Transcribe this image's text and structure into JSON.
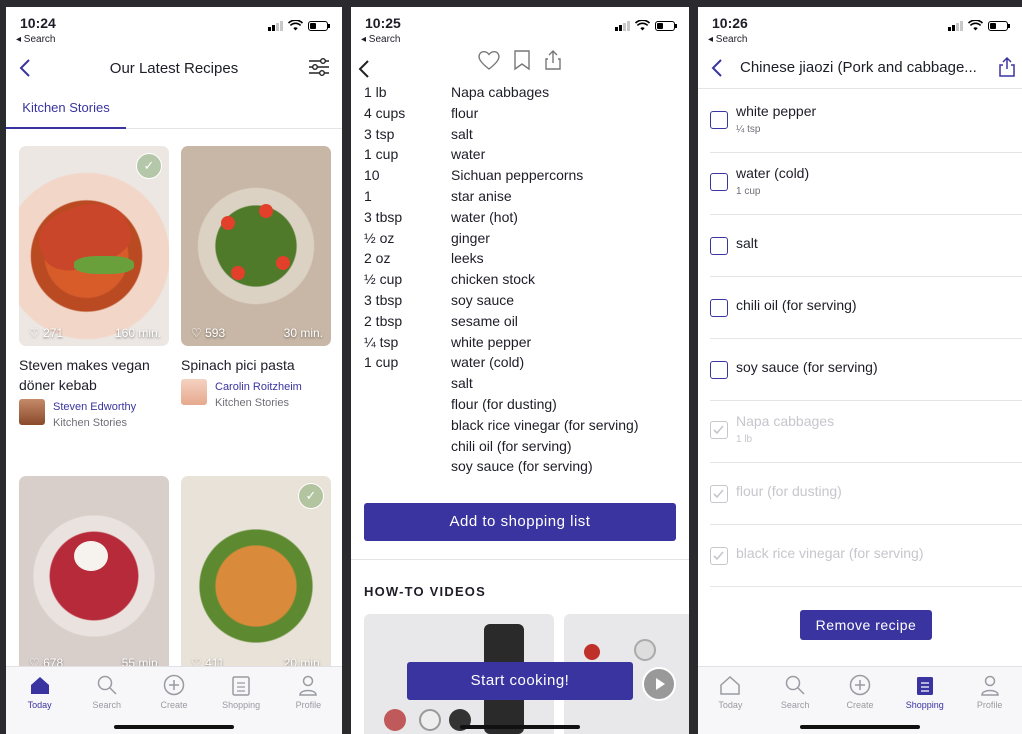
{
  "colors": {
    "accent": "#3a34a0",
    "muted": "#9a9aa3",
    "disabled": "#c6c6cc"
  },
  "screen1": {
    "status": {
      "time": "10:24",
      "back": "◂ Search"
    },
    "title": "Our Latest Recipes",
    "tab": "Kitchen Stories",
    "cards": [
      {
        "likes": "271",
        "time": "160 min.",
        "title": "Steven makes vegan döner kebab",
        "author": "Steven Edworthy",
        "publisher": "Kitchen Stories"
      },
      {
        "likes": "593",
        "time": "30 min.",
        "title": "Spinach pici pasta",
        "author": "Carolin Roitzheim",
        "publisher": "Kitchen Stories"
      },
      {
        "likes": "678",
        "time": "55 min."
      },
      {
        "likes": "411",
        "time": "20 min."
      }
    ],
    "tabbar": [
      "Today",
      "Search",
      "Create",
      "Shopping",
      "Profile"
    ]
  },
  "screen2": {
    "status": {
      "time": "10:25",
      "back": "◂ Search"
    },
    "ingredients": [
      {
        "q": "1 lb",
        "n": "Napa cabbages"
      },
      {
        "q": "4 cups",
        "n": "flour"
      },
      {
        "q": "3 tsp",
        "n": "salt"
      },
      {
        "q": "1 cup",
        "n": "water"
      },
      {
        "q": "10",
        "n": "Sichuan peppercorns"
      },
      {
        "q": "1",
        "n": "star anise"
      },
      {
        "q": "3 tbsp",
        "n": "water (hot)"
      },
      {
        "q": "½ oz",
        "n": "ginger"
      },
      {
        "q": "2 oz",
        "n": "leeks"
      },
      {
        "q": "½ cup",
        "n": "chicken stock"
      },
      {
        "q": "3 tbsp",
        "n": "soy sauce"
      },
      {
        "q": "2 tbsp",
        "n": "sesame oil"
      },
      {
        "q": "¼ tsp",
        "n": "white pepper"
      },
      {
        "q": "1 cup",
        "n": "water (cold)"
      },
      {
        "q": "",
        "n": "salt"
      },
      {
        "q": "",
        "n": "flour (for dusting)"
      },
      {
        "q": "",
        "n": "black rice vinegar (for serving)"
      },
      {
        "q": "",
        "n": "chili oil (for serving)"
      },
      {
        "q": "",
        "n": "soy sauce (for serving)"
      }
    ],
    "add_button": "Add to shopping list",
    "howto": "HOW-TO VIDEOS",
    "start_button": "Start cooking!"
  },
  "screen3": {
    "status": {
      "time": "10:26",
      "back": "◂ Search"
    },
    "title": "Chinese jiaozi (Pork and cabbage...",
    "items": [
      {
        "name": "white pepper",
        "amount": "¼ tsp",
        "done": false
      },
      {
        "name": "water (cold)",
        "amount": "1 cup",
        "done": false
      },
      {
        "name": "salt",
        "amount": "",
        "done": false
      },
      {
        "name": "chili oil (for serving)",
        "amount": "",
        "done": false
      },
      {
        "name": "soy sauce (for serving)",
        "amount": "",
        "done": false
      },
      {
        "name": "Napa cabbages",
        "amount": "1 lb",
        "done": true
      },
      {
        "name": "flour (for dusting)",
        "amount": "",
        "done": true
      },
      {
        "name": "black rice vinegar (for serving)",
        "amount": "",
        "done": true
      }
    ],
    "remove_button": "Remove recipe",
    "tabbar": [
      "Today",
      "Search",
      "Create",
      "Shopping",
      "Profile"
    ]
  }
}
